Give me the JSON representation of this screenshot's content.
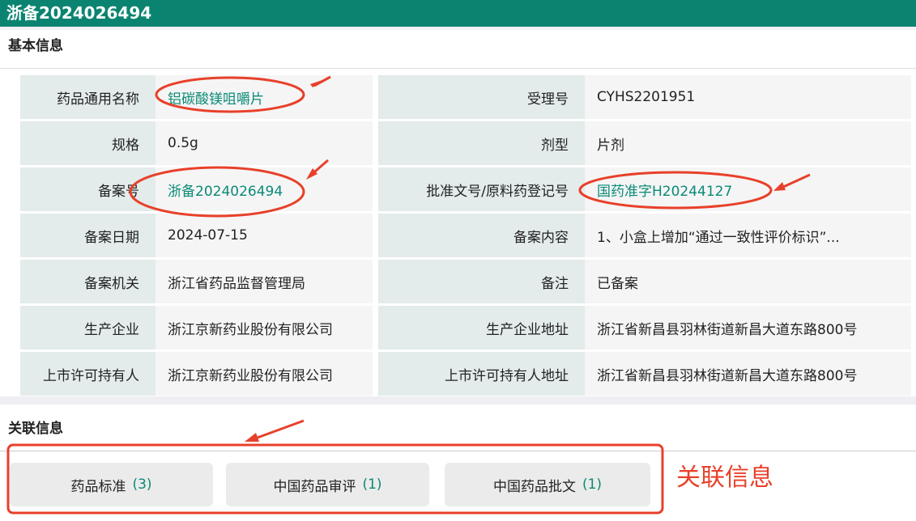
{
  "title": "浙备2024026494",
  "basic_section": "基本信息",
  "rows": [
    {
      "l1": "药品通用名称",
      "v1": "铝碳酸镁咀嚼片",
      "v1_link": true,
      "l2": "受理号",
      "v2": "CYHS2201951",
      "v2_link": false
    },
    {
      "l1": "规格",
      "v1": "0.5g",
      "v1_link": false,
      "l2": "剂型",
      "v2": "片剂",
      "v2_link": false
    },
    {
      "l1": "备案号",
      "v1": "浙备2024026494",
      "v1_link": true,
      "l2": "批准文号/原料药登记号",
      "v2": "国药准字H20244127",
      "v2_link": true
    },
    {
      "l1": "备案日期",
      "v1": "2024-07-15",
      "v1_link": false,
      "l2": "备案内容",
      "v2": "1、小盒上增加“通过一致性评价标识”...",
      "v2_link": false
    },
    {
      "l1": "备案机关",
      "v1": "浙江省药品监督管理局",
      "v1_link": false,
      "l2": "备注",
      "v2": "已备案",
      "v2_link": false
    },
    {
      "l1": "生产企业",
      "v1": "浙江京新药业股份有限公司",
      "v1_link": false,
      "l2": "生产企业地址",
      "v2": "浙江省新昌县羽林街道新昌大道东路800号",
      "v2_link": false
    },
    {
      "l1": "上市许可持有人",
      "v1": "浙江京新药业股份有限公司",
      "v1_link": false,
      "l2": "上市许可持有人地址",
      "v2": "浙江省新昌县羽林街道新昌大道东路800号",
      "v2_link": false
    }
  ],
  "related_section": "关联信息",
  "related": [
    {
      "label": "药品标准",
      "count": "(3)"
    },
    {
      "label": "中国药品审评",
      "count": "(1)"
    },
    {
      "label": "中国药品批文",
      "count": "(1)"
    }
  ],
  "annotation_text": "关联信息",
  "colors": {
    "brand": "#0a8470",
    "link": "#0a8a76",
    "annotation": "#e8402a"
  }
}
